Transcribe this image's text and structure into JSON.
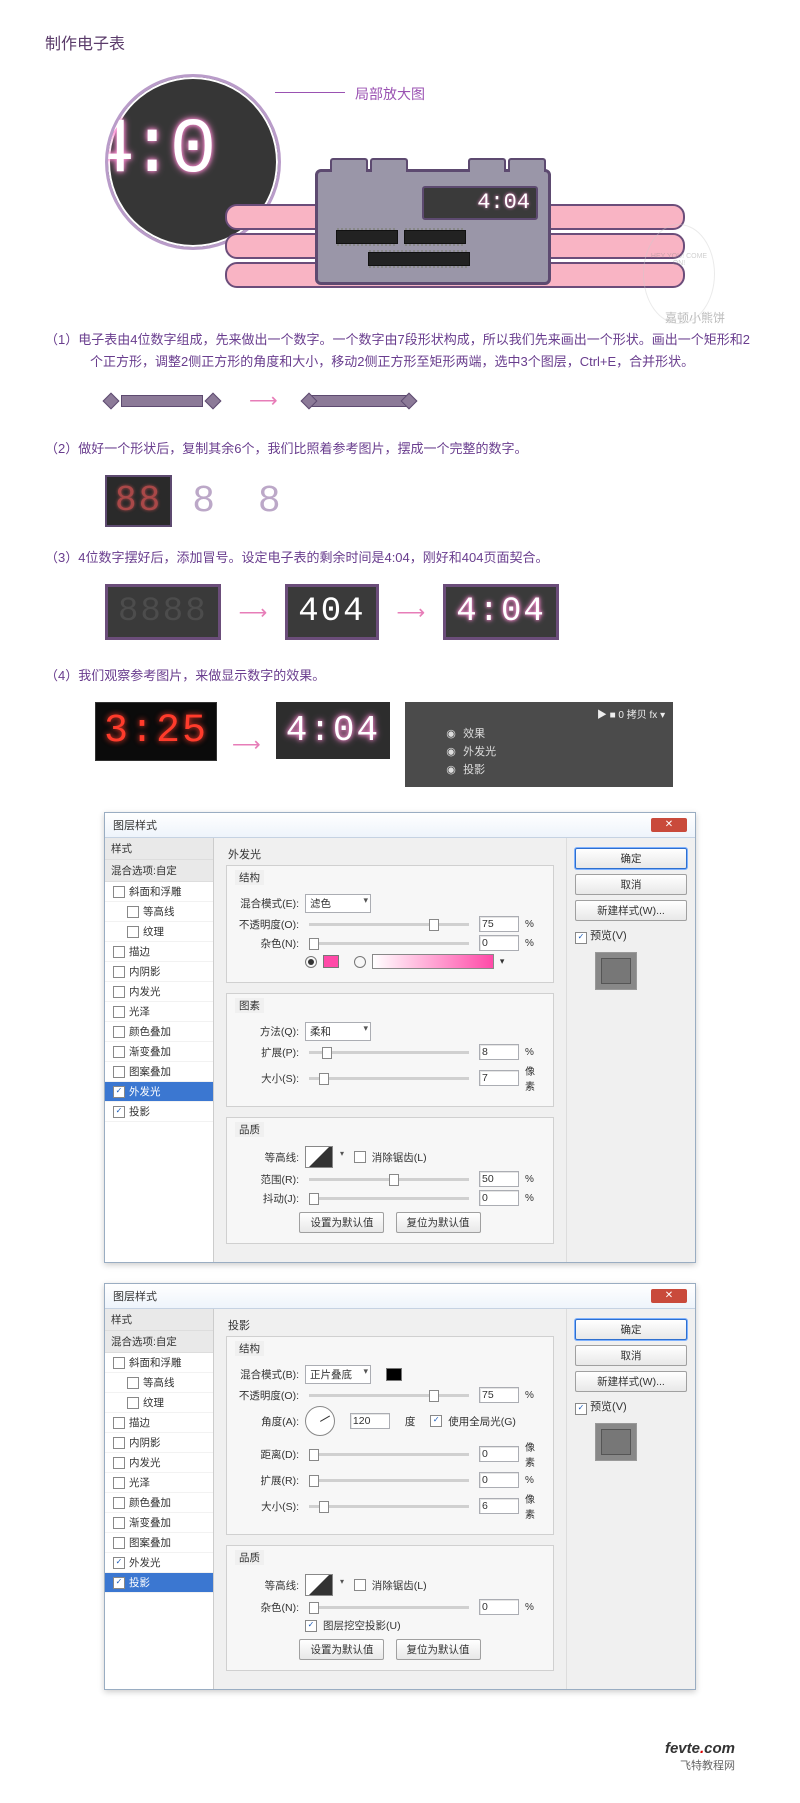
{
  "title": "制作电子表",
  "hero": {
    "zoom_label": "局部放大图",
    "zoom_digits": "4:0",
    "lcd_text": "4:04",
    "watermark_circle": "HEY YOU! COME ON!",
    "watermark_text": "嘉顿小熊饼"
  },
  "steps": {
    "s1_num": "（1）",
    "s1": "电子表由4位数字组成，先来做出一个数字。一个数字由7段形状构成，所以我们先来画出一个形状。画出一个矩形和2个正方形，调整2侧正方形的角度和大小，移动2侧正方形至矩形两端，选中3个图层，Ctrl+E，合并形状。",
    "s2_num": "（2）",
    "s2": "做好一个形状后，复制其余6个，我们比照着参考图片，摆成一个完整的数字。",
    "s3_num": "（3）",
    "s3": "4位数字摆好后，添加冒号。设定电子表的剩余时间是4:04，刚好和404页面契合。",
    "s4_num": "（4）",
    "s4": "我们观察参考图片，来做显示数字的效果。"
  },
  "digits": {
    "dark": "88",
    "outline": "8 8",
    "blank": "8888",
    "white": " 404",
    "glow": " 4:04",
    "ref_photo": "3:25",
    "ref_glow": "4:04"
  },
  "arrow": "⟶",
  "layers": {
    "header": "▶ ■  0 拷贝   fx ▾",
    "fx": "效果",
    "outerglow": "外发光",
    "shadow": "投影",
    "eye": "◉"
  },
  "dialog1": {
    "title": "图层样式",
    "panel_name": "外发光",
    "left_header": "样式",
    "left_sub": "混合选项:自定",
    "items": {
      "bevel": "斜面和浮雕",
      "contour": "等高线",
      "texture": "纹理",
      "stroke": "描边",
      "inshadow": "内阴影",
      "inglow": "内发光",
      "satin": "光泽",
      "color": "颜色叠加",
      "grad": "渐变叠加",
      "pattern": "图案叠加",
      "outglow": "外发光",
      "shadow": "投影"
    },
    "groups": {
      "structure": "结构",
      "elements": "图素",
      "quality": "品质"
    },
    "labels": {
      "blend": "混合模式(E):",
      "blend_val": "滤色",
      "opacity": "不透明度(O):",
      "opacity_val": "75",
      "noise": "杂色(N):",
      "noise_val": "0",
      "method": "方法(Q):",
      "method_val": "柔和",
      "spread": "扩展(P):",
      "spread_val": "8",
      "size": "大小(S):",
      "size_val": "7",
      "contour": "等高线:",
      "anti": "消除锯齿(L)",
      "range": "范围(R):",
      "range_val": "50",
      "jitter": "抖动(J):",
      "jitter_val": "0",
      "pct": "%",
      "px": "像素"
    },
    "buttons": {
      "ok": "确定",
      "cancel": "取消",
      "newstyle": "新建样式(W)...",
      "preview": "预览(V)",
      "default1": "设置为默认值",
      "default2": "复位为默认值"
    }
  },
  "dialog2": {
    "title": "图层样式",
    "panel_name": "投影",
    "groups": {
      "structure": "结构",
      "quality": "品质"
    },
    "labels": {
      "blend": "混合模式(B):",
      "blend_val": "正片叠底",
      "opacity": "不透明度(O):",
      "opacity_val": "75",
      "angle": "角度(A):",
      "angle_val": "120",
      "angle_unit": "度",
      "global": "使用全局光(G)",
      "distance": "距离(D):",
      "distance_val": "0",
      "spread": "扩展(R):",
      "spread_val": "0",
      "size": "大小(S):",
      "size_val": "6",
      "contour": "等高线:",
      "anti": "消除锯齿(L)",
      "noise": "杂色(N):",
      "noise_val": "0",
      "knock": "图层挖空投影(U)",
      "pct": "%",
      "px": "像素"
    }
  },
  "footer": {
    "brand1": "fevte",
    "dot": ".",
    "brand2": "com",
    "sub": "飞特教程网"
  }
}
